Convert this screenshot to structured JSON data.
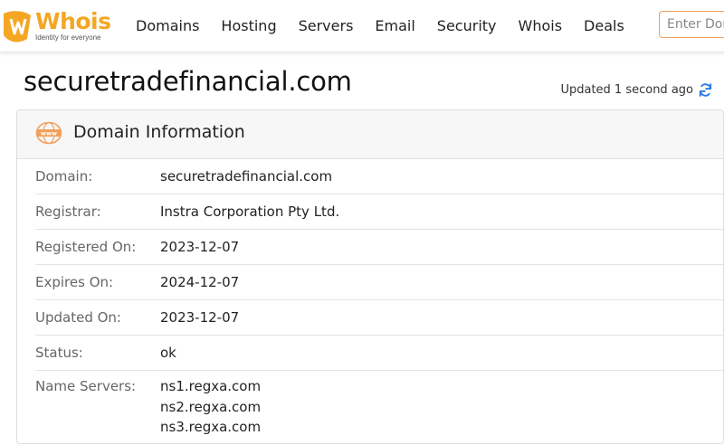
{
  "header": {
    "logo_text": "Whois",
    "logo_tagline": "Identity for everyone",
    "nav": [
      "Domains",
      "Hosting",
      "Servers",
      "Email",
      "Security",
      "Whois",
      "Deals"
    ],
    "search_placeholder": "Enter Domain or IP"
  },
  "page": {
    "title": "securetradefinancial.com",
    "updated_text": "Updated 1 second ago"
  },
  "card": {
    "title": "Domain Information",
    "rows": [
      {
        "label": "Domain:",
        "value": "securetradefinancial.com"
      },
      {
        "label": "Registrar:",
        "value": "Instra Corporation Pty Ltd."
      },
      {
        "label": "Registered On:",
        "value": "2023-12-07"
      },
      {
        "label": "Expires On:",
        "value": "2024-12-07"
      },
      {
        "label": "Updated On:",
        "value": "2023-12-07"
      },
      {
        "label": "Status:",
        "value": "ok"
      }
    ],
    "name_servers_label": "Name Servers:",
    "name_servers": [
      "ns1.regxa.com",
      "ns2.regxa.com",
      "ns3.regxa.com"
    ]
  },
  "colors": {
    "brand": "#f5a623",
    "accent_border": "#f0a05a",
    "refresh_icon": "#2a7ae2"
  },
  "icons": {
    "logo": "whois-logo-icon",
    "card": "www-globe-icon",
    "refresh": "refresh-icon"
  }
}
